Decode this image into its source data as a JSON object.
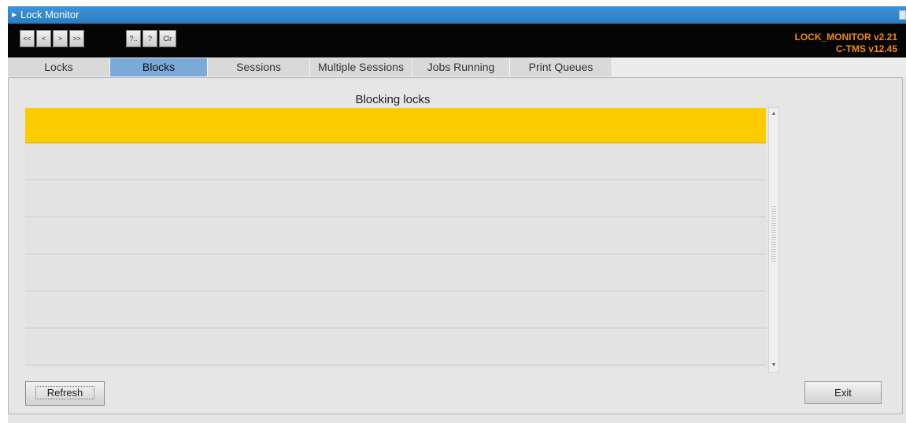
{
  "window": {
    "title": "Lock Monitor"
  },
  "toolbar": {
    "buttons": [
      {
        "label": "<<"
      },
      {
        "label": "<"
      },
      {
        "label": ">"
      },
      {
        "label": ">>"
      },
      {
        "label": "?.."
      },
      {
        "label": "?"
      },
      {
        "label": "Clr"
      }
    ],
    "version_line_1": "LOCK_MONITOR v2.21",
    "version_line_2": "C-TMS v12.45",
    "version_color": "#f08a1a"
  },
  "tabs": [
    {
      "label": "Locks",
      "active": false
    },
    {
      "label": "Blocks",
      "active": true
    },
    {
      "label": "Sessions",
      "active": false
    },
    {
      "label": "Multiple Sessions",
      "active": false
    },
    {
      "label": "Jobs Running",
      "active": false
    },
    {
      "label": "Print Queues",
      "active": false
    }
  ],
  "main": {
    "section_title": "Blocking locks",
    "rows": [
      {
        "selected": true
      },
      {
        "selected": false
      },
      {
        "selected": false
      },
      {
        "selected": false
      },
      {
        "selected": false
      },
      {
        "selected": false
      },
      {
        "selected": false
      }
    ],
    "selected_row_color": "#fdcc00"
  },
  "footer": {
    "refresh_label": "Refresh",
    "exit_label": "Exit"
  },
  "icons": {
    "app": "window-icon",
    "minimize": "minimize-icon",
    "scroll_up": "scroll-up-arrow-icon",
    "scroll_down": "scroll-down-arrow-icon"
  }
}
